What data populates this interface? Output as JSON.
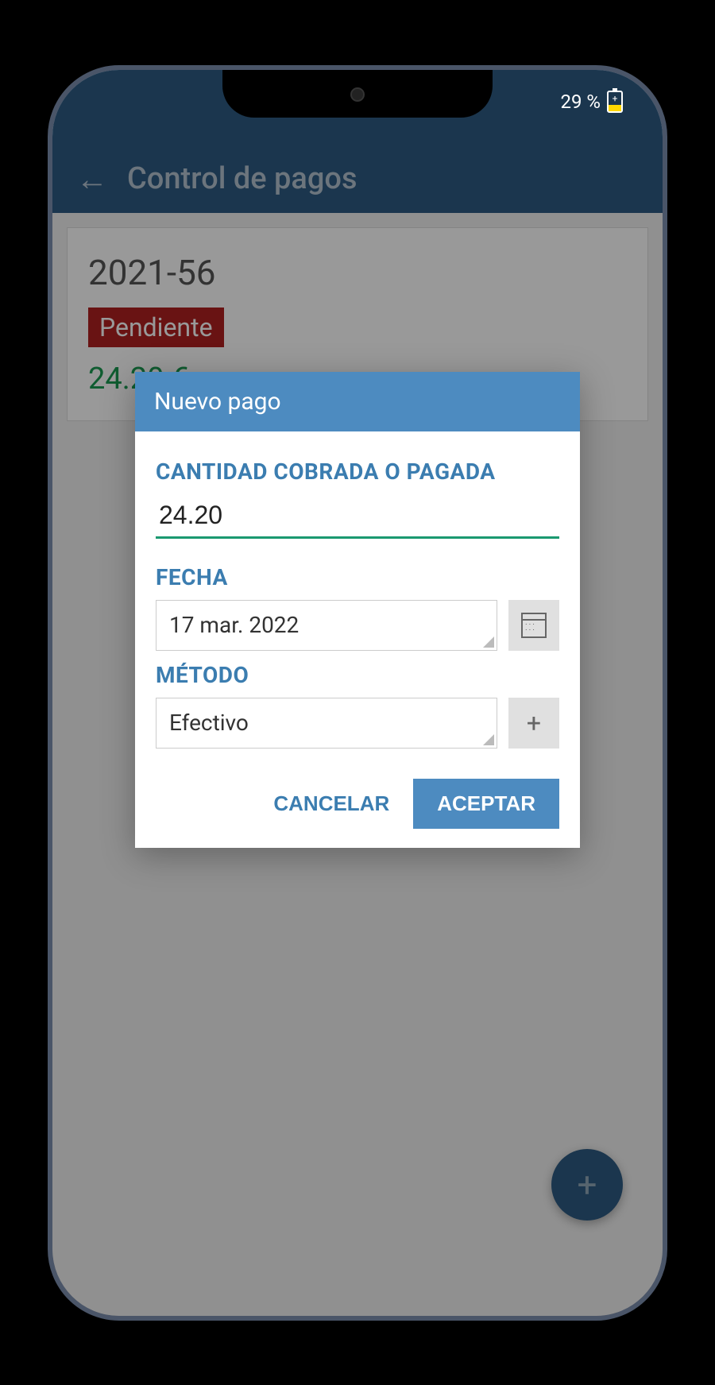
{
  "status_bar": {
    "battery_percent": "29 %"
  },
  "app_bar": {
    "title": "Control de pagos"
  },
  "invoice": {
    "id": "2021-56",
    "status": "Pendiente",
    "amount": "24.20 €"
  },
  "dialog": {
    "title": "Nuevo pago",
    "amount_label": "CANTIDAD COBRADA O PAGADA",
    "amount_value": "24.20",
    "date_label": "FECHA",
    "date_value": "17 mar. 2022",
    "method_label": "MÉTODO",
    "method_value": "Efectivo",
    "cancel_label": "CANCELAR",
    "accept_label": "ACEPTAR"
  }
}
